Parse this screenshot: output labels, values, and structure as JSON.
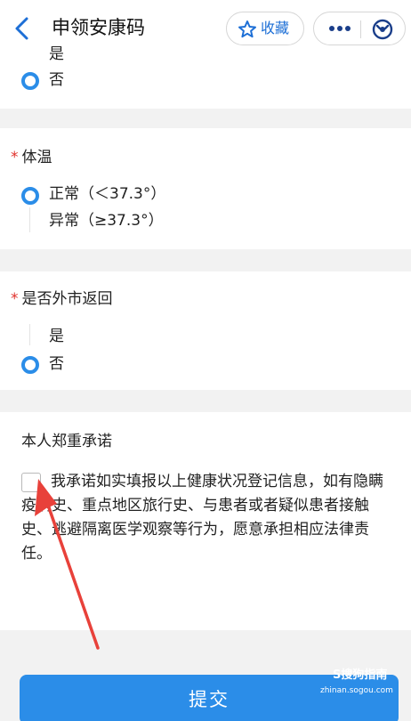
{
  "header": {
    "title": "申领安康码",
    "favorite_label": "收藏"
  },
  "q_prev": {
    "partial_option": "是",
    "selected_option": "否"
  },
  "q_temperature": {
    "required_mark": "*",
    "title": "体温",
    "options": [
      {
        "label": "正常（＜37.3°）",
        "selected": true
      },
      {
        "label": "异常（≥37.3°）",
        "selected": false
      }
    ]
  },
  "q_return": {
    "required_mark": "*",
    "title": "是否外市返回",
    "options": [
      {
        "label": "是",
        "selected": false
      },
      {
        "label": "否",
        "selected": true
      }
    ]
  },
  "pledge": {
    "title": "本人郑重承诺",
    "text": "我承诺如实填报以上健康状况登记信息，如有隐瞒疫病史、重点地区旅行史、与患者或者疑似患者接触史、逃避隔离医学观察等行为，愿意承担相应法律责任。",
    "checked": false
  },
  "submit_label": "提交",
  "watermark": {
    "main": "S搜狗指南",
    "sub": "zhinan.sogou.com"
  },
  "colors": {
    "accent": "#2b8de8",
    "required": "#e0312b",
    "annotation_arrow": "#e8413a"
  }
}
